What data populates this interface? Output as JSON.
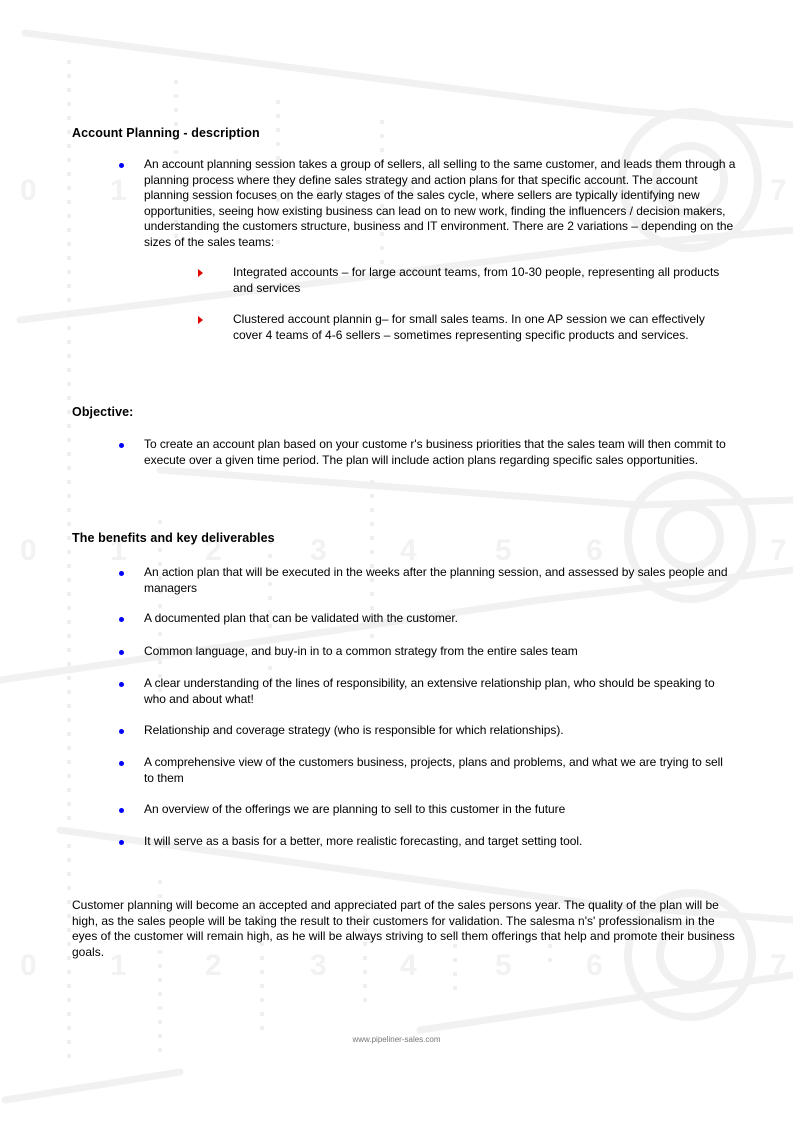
{
  "document": {
    "sections": [
      {
        "heading": "Account Planning - description",
        "bullets": [
          "An account planning session takes a group of sellers, all selling to the same customer, and leads them through a planning process where they define sales strategy and action plans for that specific account. The account planning session focuses on the early stages of the sales cycle, where sellers are typically identifying new opportunities, seeing how existing business can lead on to new work, finding the influencers / decision makers, understanding the customers structure, business and IT environment. There are 2 variations    – depending on the sizes of the sales teams:"
        ],
        "sub_bullets": [
          "Integrated accounts  – for large account teams, from 10-30 people, representing all products and services",
          "Clustered account plannin g– for small sales teams. In one AP session we can effectively cover 4 teams of 4-6 sellers   – sometimes representing specific products and services."
        ]
      },
      {
        "heading": "Objective:",
        "bullets": [
          "To create an account plan based on your custome r's business priorities that the sales team will then commit to execute over a given time period. The plan will include action plans regarding specific sales opportunities."
        ]
      },
      {
        "heading": "The benefits and key deliverables",
        "bullets": [
          "An action plan that will be executed in the weeks after the planning session, and assessed by sales people and managers",
          "A documented plan that can be validated with the customer.",
          "Common language, and buy-in in to a common strategy from the entire sales team",
          "A clear understanding of the lines of responsibility, an extensive relationship plan, who should be speaking to who and about what!",
          "Relationship and coverage strategy (who is responsible for which relationships).",
          "A comprehensive view of the customers business, projects, plans and problems, and what we are trying to sell to them",
          "An  overview  of  the offerings we are planning to sell to this customer in the future",
          "It will serve as a basis for a better, more realistic forecasting, and target setting tool."
        ]
      }
    ],
    "closing_paragraph": "Customer planning will become an accepted and appreciated part of the sales persons year. The quality of the plan will be high, as the sales people will be taking the result to their customers for validation. The salesma   n's' professionalism in the eyes of the customer will remain high, as he will be always striving to sell them offerings that help and promote their business goals.",
    "footer": "www.pipeliner-sales.com"
  },
  "watermark": {
    "scale_labels": [
      "0",
      "1",
      "2",
      "3",
      "4",
      "5",
      "6",
      "7"
    ],
    "color": "#f0f0f0"
  },
  "colors": {
    "bullet": "#0000ff",
    "sub_bullet": "#e00000",
    "text": "#000000",
    "footer": "#777777"
  }
}
